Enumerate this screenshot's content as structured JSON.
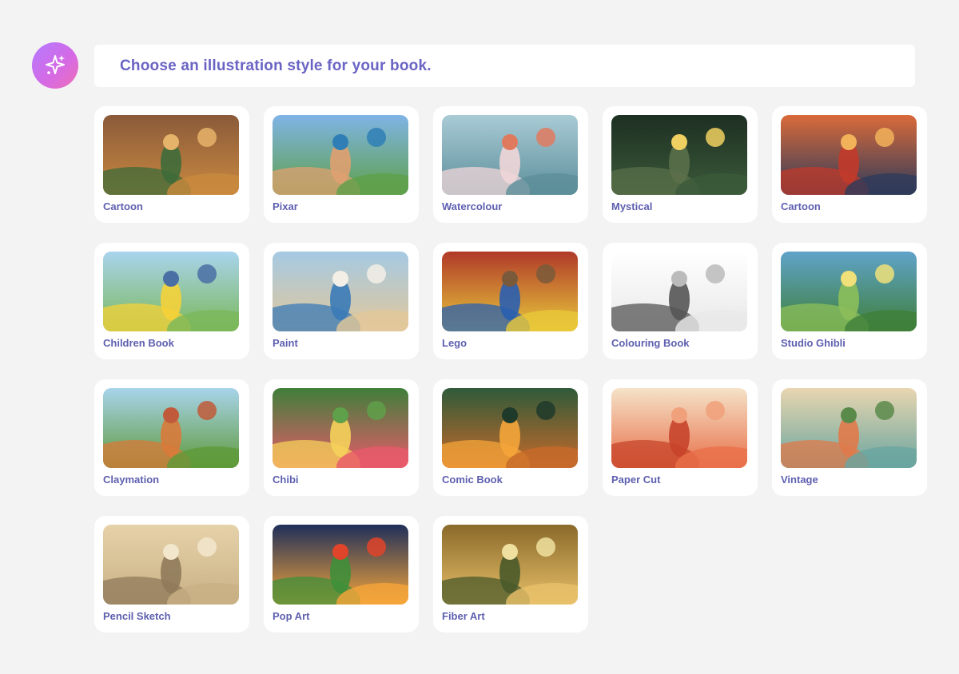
{
  "prompt": {
    "text": "Choose an illustration style for your book.",
    "icon": "sparkles-icon"
  },
  "styles": [
    {
      "label": "Cartoon",
      "colors": [
        "#8a5a3a",
        "#c9893f",
        "#3e6b3a",
        "#e6b36a"
      ]
    },
    {
      "label": "Pixar",
      "colors": [
        "#7fb4e6",
        "#5fa04a",
        "#e0a070",
        "#2f7fb6"
      ]
    },
    {
      "label": "Watercolour",
      "colors": [
        "#a9cbd6",
        "#5c8f9a",
        "#f0d6d8",
        "#e07a5f"
      ]
    },
    {
      "label": "Mystical",
      "colors": [
        "#1d2f22",
        "#3b5a3a",
        "#5a6f4a",
        "#f0d060"
      ]
    },
    {
      "label": "Cartoon",
      "colors": [
        "#d96a3a",
        "#2f3b5a",
        "#c23a2a",
        "#f2b25a"
      ]
    },
    {
      "label": "Children Book",
      "colors": [
        "#a9d4ee",
        "#7bb85a",
        "#f5d23a",
        "#4a6fa5"
      ]
    },
    {
      "label": "Paint",
      "colors": [
        "#a5c9e3",
        "#e2c89a",
        "#3a7ab7",
        "#f3efe6"
      ]
    },
    {
      "label": "Lego",
      "colors": [
        "#b03a2a",
        "#e8c83a",
        "#2a5fb0",
        "#7a5a3a"
      ]
    },
    {
      "label": "Colouring Book",
      "colors": [
        "#ffffff",
        "#e8e8e8",
        "#555555",
        "#bbbbbb"
      ]
    },
    {
      "label": "Studio Ghibli",
      "colors": [
        "#5fa3c9",
        "#3f7f3a",
        "#8cbf5a",
        "#f0e07a"
      ]
    },
    {
      "label": "Claymation",
      "colors": [
        "#a8d4ec",
        "#5f9a3a",
        "#d87a3a",
        "#c05a3a"
      ]
    },
    {
      "label": "Chibi",
      "colors": [
        "#3f7f3a",
        "#e85a6a",
        "#f5d15a",
        "#5fa04a"
      ]
    },
    {
      "label": "Comic Book",
      "colors": [
        "#2f5a3a",
        "#c76a2a",
        "#f5a53a",
        "#1f3a2a"
      ]
    },
    {
      "label": "Paper Cut",
      "colors": [
        "#f5e3c8",
        "#e8704a",
        "#c7442a",
        "#f0a07a"
      ]
    },
    {
      "label": "Vintage",
      "colors": [
        "#e8d6b0",
        "#6aa5a0",
        "#e07a4a",
        "#5a8a4a"
      ]
    },
    {
      "label": "Pencil Sketch",
      "colors": [
        "#e6d2aa",
        "#c9b084",
        "#8f7a5a",
        "#f2e6cc"
      ]
    },
    {
      "label": "Pop Art",
      "colors": [
        "#1f2f5a",
        "#f5a53a",
        "#3f8f3a",
        "#e0442a"
      ]
    },
    {
      "label": "Fiber Art",
      "colors": [
        "#8a6a2a",
        "#e8c06a",
        "#4a5a2a",
        "#f0e0a0"
      ]
    }
  ]
}
